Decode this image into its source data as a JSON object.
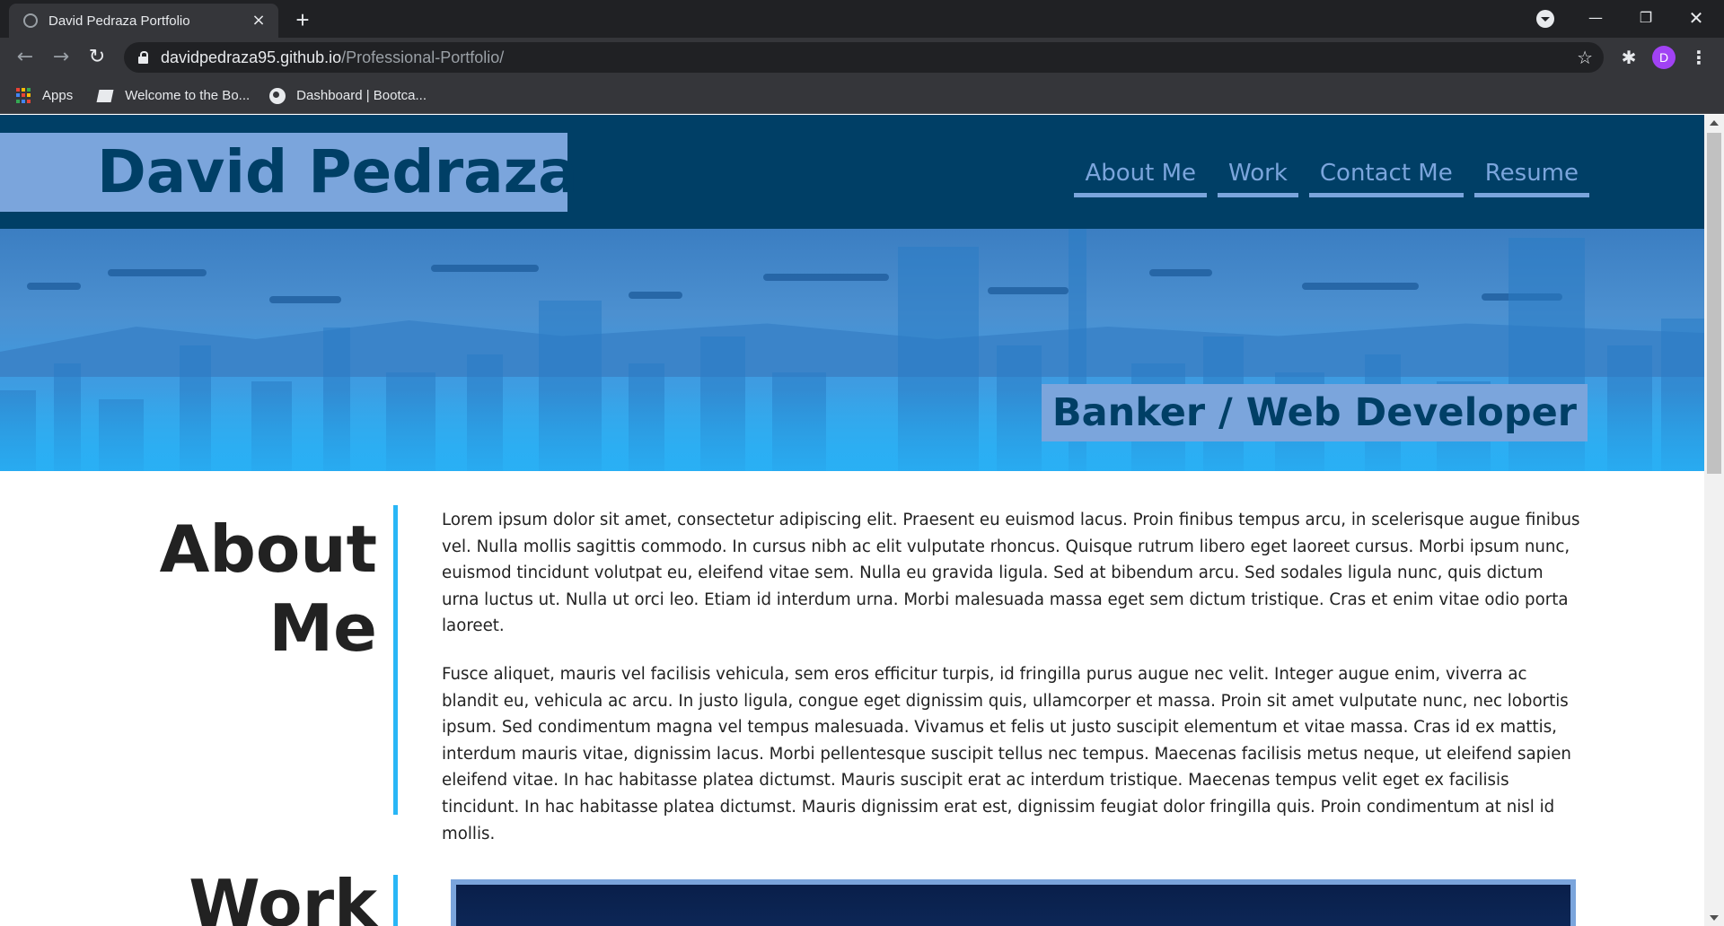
{
  "browser": {
    "tab_title": "David Pedraza Portfolio",
    "tab_close": "×",
    "new_tab": "+",
    "url_host": "davidpedraza95.github.io",
    "url_path": "/Professional-Portfolio/",
    "avatar_initial": "D",
    "bookmarks": [
      {
        "label": "Apps",
        "icon": "apps-grid-icon"
      },
      {
        "label": "Welcome to the Bo...",
        "icon": "book-icon"
      },
      {
        "label": "Dashboard | Bootca...",
        "icon": "globe-icon"
      }
    ],
    "apps_colors": [
      "#ea4335",
      "#fbbc05",
      "#34a853",
      "#4285f4",
      "#ea4335",
      "#fbbc05",
      "#34a853",
      "#4285f4",
      "#ea4335"
    ]
  },
  "site": {
    "title": "David Pedraza",
    "nav": [
      "About Me",
      "Work",
      "Contact Me",
      "Resume"
    ],
    "tagline": "Banker / Web Developer",
    "colors": {
      "header_bg": "#003f66",
      "accent_light": "#7ba5dc",
      "divider": "#29b6f6"
    },
    "about": {
      "heading": "About Me",
      "paragraphs": [
        "Lorem ipsum dolor sit amet, consectetur adipiscing elit. Praesent eu euismod lacus. Proin finibus tempus arcu, in scelerisque augue finibus vel. Nulla mollis sagittis commodo. In cursus nibh ac elit vulputate rhoncus. Quisque rutrum libero eget laoreet cursus. Morbi ipsum nunc, euismod tincidunt volutpat eu, eleifend vitae sem. Nulla eu gravida ligula. Sed at bibendum arcu. Sed sodales ligula nunc, quis dictum urna luctus ut. Nulla ut orci leo. Etiam id interdum urna. Morbi malesuada massa eget sem dictum tristique. Cras et enim vitae odio porta laoreet.",
        "Fusce aliquet, mauris vel facilisis vehicula, sem eros efficitur turpis, id fringilla purus augue nec velit. Integer augue enim, viverra ac blandit eu, vehicula ac arcu. In justo ligula, congue eget dignissim quis, ullamcorper et massa. Proin sit amet vulputate nunc, nec lobortis ipsum. Sed condimentum magna vel tempus malesuada. Vivamus et felis ut justo suscipit elementum et vitae massa. Cras id ex mattis, interdum mauris vitae, dignissim lacus. Morbi pellentesque suscipit tellus nec tempus. Maecenas facilisis metus neque, ut eleifend sapien eleifend vitae. In hac habitasse platea dictumst. Mauris suscipit erat ac interdum tristique. Maecenas tempus velit eget ex facilisis tincidunt. In hac habitasse platea dictumst. Mauris dignissim erat est, dignissim feugiat dolor fringilla quis. Proin condimentum at nisl id mollis."
      ]
    },
    "work": {
      "heading": "Work"
    }
  }
}
